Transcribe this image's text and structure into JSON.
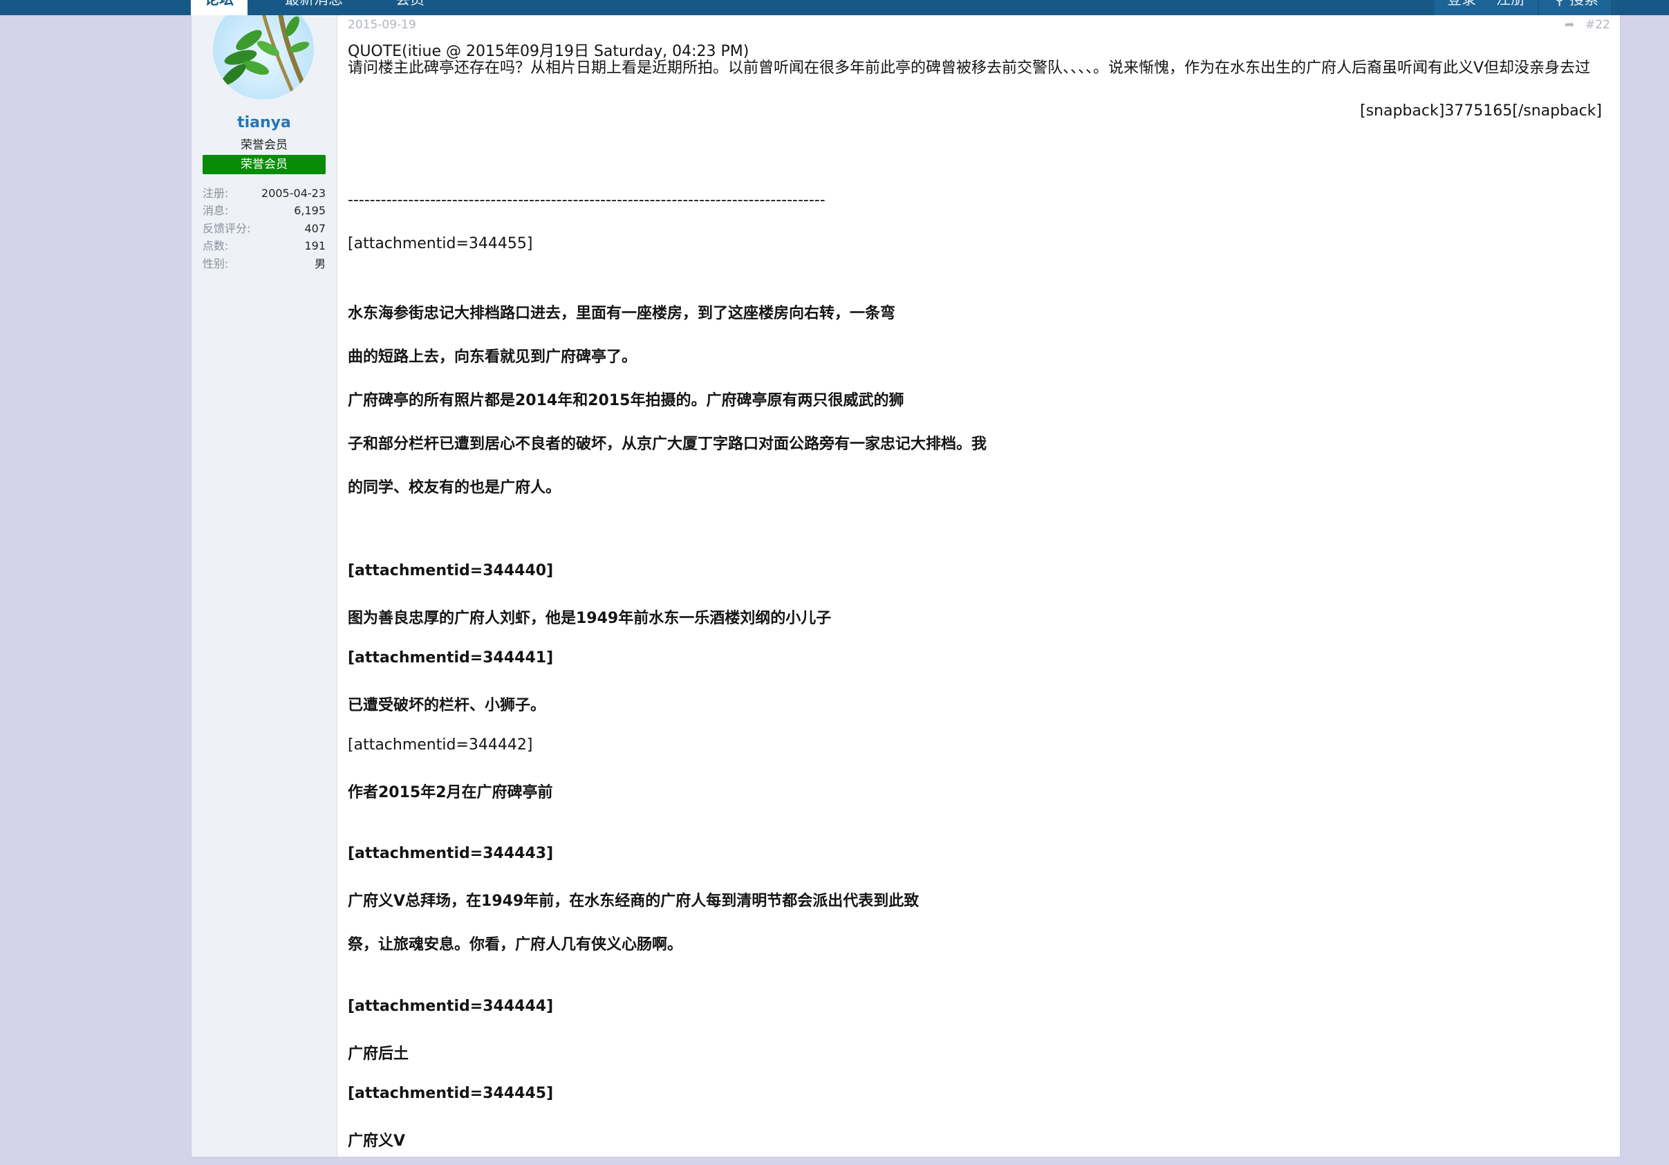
{
  "nav": {
    "tabs": [
      "论坛",
      "最新消息",
      "会员"
    ],
    "login": "登录",
    "register": "注册",
    "search": "搜索"
  },
  "post": {
    "date": "2015-09-19",
    "number": "#22",
    "user": {
      "name": "tianya",
      "title": "荣誉会员",
      "banner": "荣誉会员",
      "stats": [
        {
          "label": "注册:",
          "value": "2005-04-23"
        },
        {
          "label": "消息:",
          "value": "6,195"
        },
        {
          "label": "反馈评分:",
          "value": "407"
        },
        {
          "label": "点数:",
          "value": "191"
        },
        {
          "label": "性别:",
          "value": "男"
        }
      ]
    },
    "quote": {
      "header": "QUOTE(itiue @ 2015年09月19日 Saturday, 04:23 PM)",
      "body": "请问楼主此碑亭还存在吗？从相片日期上看是近期所拍。以前曾听闻在很多年前此亭的碑曾被移去前交警队、、、、。说来惭愧，作为在水东出生的广府人后裔虽听闻有此义V但却没亲身去过",
      "snapback": "[snapback]3775165[/snapback]"
    },
    "separator": "---------------------------------------------------------------------------------------",
    "lines": [
      "[attachmentid=344455]",
      "水东海参街忠记大排档路口进去，里面有一座楼房，到了这座楼房向右转，一条弯",
      "曲的短路上去，向东看就见到广府碑亭了。",
      "广府碑亭的所有照片都是2014年和2015年拍摄的。广府碑亭原有两只很威武的狮",
      "子和部分栏杆已遭到居心不良者的破坏，从京广大厦丁字路口对面公路旁有一家忠记大排档。我",
      "的同学、校友有的也是广府人。",
      "[attachmentid=344440]",
      "图为善良忠厚的广府人刘虾，他是1949年前水东一乐酒楼刘纲的小儿子",
      "[attachmentid=344441]",
      "已遭受破坏的栏杆、小狮子。",
      "[attachmentid=344442]",
      "作者2015年2月在广府碑亭前",
      "[attachmentid=344443]",
      "广府义V总拜场，在1949年前，在水东经商的广府人每到清明节都会派出代表到此致",
      "祭，让旅魂安息。你看，广府人几有侠义心肠啊。",
      "[attachmentid=344444]",
      "广府后土",
      "[attachmentid=344445]",
      "广府义V"
    ]
  }
}
